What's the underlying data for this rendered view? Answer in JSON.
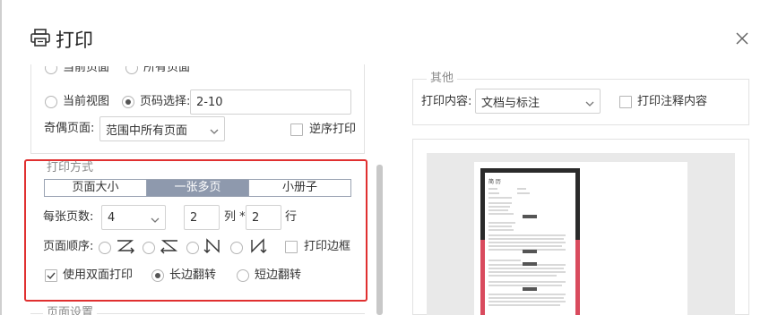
{
  "dialog": {
    "title": "打印"
  },
  "range": {
    "current_page": "当前页面",
    "all_pages": "所有页面",
    "current_view": "当前视图",
    "page_select_label": "页码选择:",
    "page_select_value": "2-10",
    "odd_even_label": "奇偶页面:",
    "odd_even_value": "范围中所有页面",
    "reverse_label": "逆序打印"
  },
  "print_mode": {
    "legend": "打印方式",
    "tabs": [
      "页面大小",
      "一张多页",
      "小册子"
    ],
    "active_tab": 1,
    "pages_per_sheet_label": "每张页数:",
    "pages_per_sheet_value": "4",
    "cols_value": "2",
    "cols_label": "列 *",
    "rows_value": "2",
    "rows_label": "行",
    "order_label": "页面顺序:",
    "print_border_label": "打印边框",
    "duplex_label": "使用双面打印",
    "duplex_checked": true,
    "long_edge_label": "长边翻转",
    "short_edge_label": "短边翻转",
    "flip_selected": "long"
  },
  "page_setup": {
    "legend": "页面设置"
  },
  "other": {
    "legend": "其他",
    "content_label": "打印内容:",
    "content_value": "文档与标注",
    "print_notes_label": "打印注释内容"
  },
  "preview": {
    "resume_name": "简 历",
    "highlight_color": "#e03030",
    "accent_red": "#d94b5e"
  }
}
